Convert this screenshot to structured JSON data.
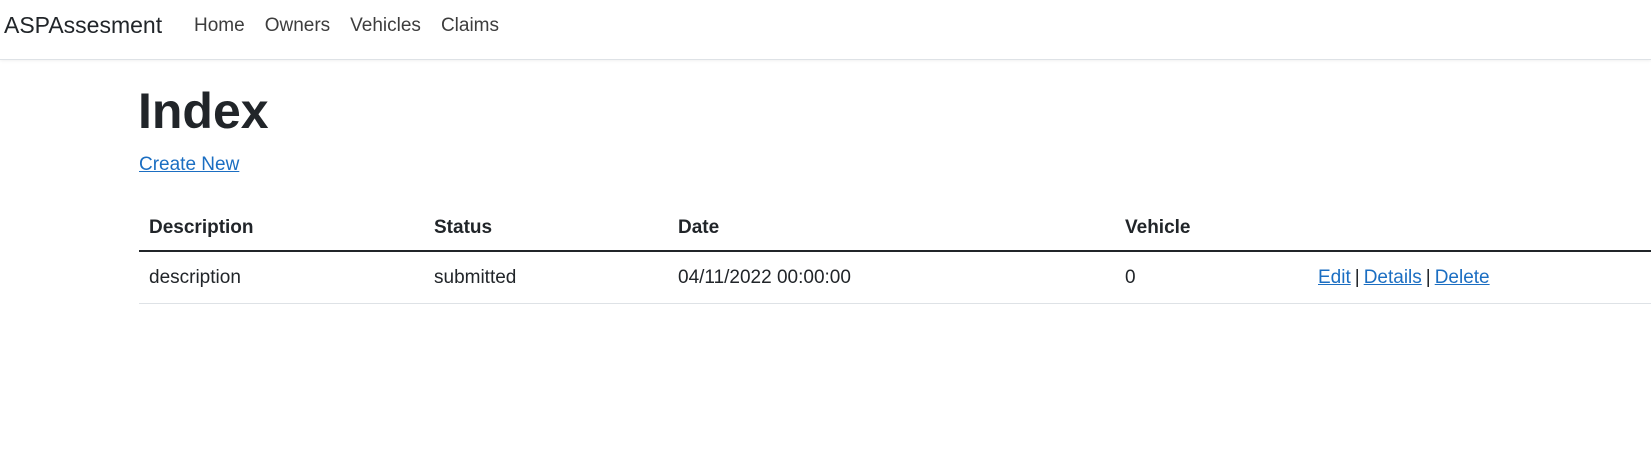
{
  "navbar": {
    "brand": "ASPAssesment",
    "links": [
      "Home",
      "Owners",
      "Vehicles",
      "Claims"
    ]
  },
  "page": {
    "title": "Index",
    "create_link": "Create New"
  },
  "table": {
    "headers": [
      "Description",
      "Status",
      "Date",
      "Vehicle",
      ""
    ],
    "rows": [
      {
        "description": "description",
        "status": "submitted",
        "date": "04/11/2022 00:00:00",
        "vehicle": "0",
        "actions": [
          "Edit",
          "Details",
          "Delete"
        ]
      }
    ],
    "separator": "|"
  },
  "colors": {
    "link": "#1b6ec2",
    "text": "#212529"
  }
}
